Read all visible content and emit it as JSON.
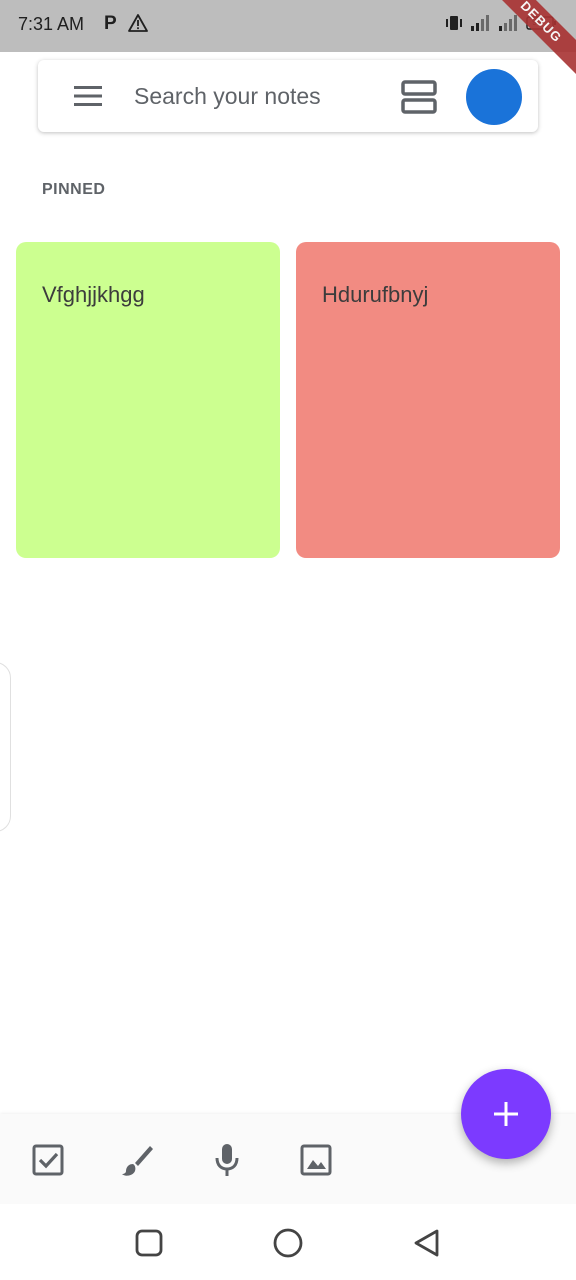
{
  "status_bar": {
    "time": "7:31 AM",
    "p_indicator": "P",
    "battery": "99",
    "icons": [
      "warning-icon",
      "vibrate-icon",
      "signal-icon",
      "signal-icon",
      "battery-icon"
    ]
  },
  "debug_banner": "DEBUG",
  "search": {
    "placeholder": "Search your notes",
    "value": ""
  },
  "section": {
    "pinned_label": "PINNED"
  },
  "notes": [
    {
      "title": "Vfghjjkhgg",
      "color": "#ccff90"
    },
    {
      "title": "Hdurufbnyj",
      "color": "#f28b82"
    }
  ],
  "toolbar": {
    "items": [
      "checkbox-icon",
      "brush-icon",
      "mic-icon",
      "image-icon"
    ]
  },
  "colors": {
    "status_bar": "#bdbdbd",
    "avatar": "#1a73d9",
    "fab": "#7c3aff",
    "icon": "#5f6368"
  }
}
